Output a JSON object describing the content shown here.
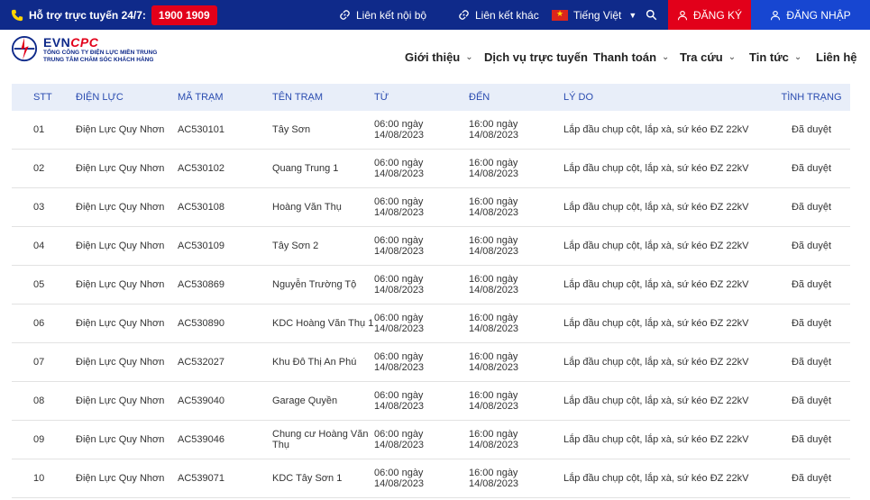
{
  "topbar": {
    "support_label": "Hỗ trợ trực tuyến 24/7:",
    "hotline": "1900 1909",
    "internal_link": "Liên kết nội bộ",
    "other_link": "Liên kết khác",
    "language": "Tiếng Việt",
    "register": "ĐĂNG KÝ",
    "login": "ĐĂNG NHẬP"
  },
  "logo": {
    "brand_evn": "EVN",
    "brand_cpc": "CPC",
    "line1": "TỔNG CÔNG TY ĐIỆN LỰC MIỀN TRUNG",
    "line2": "TRUNG TÂM CHĂM SÓC KHÁCH HÀNG"
  },
  "nav": [
    "Giới thiệu",
    "Dịch vụ trực tuyến",
    "Thanh toán",
    "Tra cứu",
    "Tin tức",
    "Liên hệ"
  ],
  "table": {
    "headers": [
      "STT",
      "ĐIỆN LỰC",
      "MÃ TRẠM",
      "TÊN TRẠM",
      "TỪ",
      "ĐẾN",
      "LÝ DO",
      "TÌNH TRẠNG"
    ],
    "rows": [
      {
        "stt": "01",
        "dl": "Điện Lực Quy Nhơn",
        "ma": "AC530101",
        "ten": "Tây Sơn",
        "tu": "06:00 ngày 14/08/2023",
        "den": "16:00 ngày 14/08/2023",
        "ly": "Lắp đầu chụp cột, lắp xà, sứ kéo ĐZ 22kV",
        "tt": "Đã duyệt"
      },
      {
        "stt": "02",
        "dl": "Điện Lực Quy Nhơn",
        "ma": "AC530102",
        "ten": "Quang Trung 1",
        "tu": "06:00 ngày 14/08/2023",
        "den": "16:00 ngày 14/08/2023",
        "ly": "Lắp đầu chụp cột, lắp xà, sứ kéo ĐZ 22kV",
        "tt": "Đã duyệt"
      },
      {
        "stt": "03",
        "dl": "Điện Lực Quy Nhơn",
        "ma": "AC530108",
        "ten": "Hoàng Văn Thụ",
        "tu": "06:00 ngày 14/08/2023",
        "den": "16:00 ngày 14/08/2023",
        "ly": "Lắp đầu chụp cột, lắp xà, sứ kéo ĐZ 22kV",
        "tt": "Đã duyệt"
      },
      {
        "stt": "04",
        "dl": "Điện Lực Quy Nhơn",
        "ma": "AC530109",
        "ten": "Tây Sơn 2",
        "tu": "06:00 ngày 14/08/2023",
        "den": "16:00 ngày 14/08/2023",
        "ly": "Lắp đầu chụp cột, lắp xà, sứ kéo ĐZ 22kV",
        "tt": "Đã duyệt"
      },
      {
        "stt": "05",
        "dl": "Điện Lực Quy Nhơn",
        "ma": "AC530869",
        "ten": "Nguyễn Trường Tộ",
        "tu": "06:00 ngày 14/08/2023",
        "den": "16:00 ngày 14/08/2023",
        "ly": "Lắp đầu chụp cột, lắp xà, sứ kéo ĐZ 22kV",
        "tt": "Đã duyệt"
      },
      {
        "stt": "06",
        "dl": "Điện Lực Quy Nhơn",
        "ma": "AC530890",
        "ten": "KDC Hoàng Văn Thụ 1",
        "tu": "06:00 ngày 14/08/2023",
        "den": "16:00 ngày 14/08/2023",
        "ly": "Lắp đầu chụp cột, lắp xà, sứ kéo ĐZ 22kV",
        "tt": "Đã duyệt"
      },
      {
        "stt": "07",
        "dl": "Điện Lực Quy Nhơn",
        "ma": "AC532027",
        "ten": "Khu Đô Thị An Phú",
        "tu": "06:00 ngày 14/08/2023",
        "den": "16:00 ngày 14/08/2023",
        "ly": "Lắp đầu chụp cột, lắp xà, sứ kéo ĐZ 22kV",
        "tt": "Đã duyệt"
      },
      {
        "stt": "08",
        "dl": "Điện Lực Quy Nhơn",
        "ma": "AC539040",
        "ten": "Garage Quyền",
        "tu": "06:00 ngày 14/08/2023",
        "den": "16:00 ngày 14/08/2023",
        "ly": "Lắp đầu chụp cột, lắp xà, sứ kéo ĐZ 22kV",
        "tt": "Đã duyệt"
      },
      {
        "stt": "09",
        "dl": "Điện Lực Quy Nhơn",
        "ma": "AC539046",
        "ten": "Chung cư Hoàng Văn Thụ",
        "tu": "06:00 ngày 14/08/2023",
        "den": "16:00 ngày 14/08/2023",
        "ly": "Lắp đầu chụp cột, lắp xà, sứ kéo ĐZ 22kV",
        "tt": "Đã duyệt"
      },
      {
        "stt": "10",
        "dl": "Điện Lực Quy Nhơn",
        "ma": "AC539071",
        "ten": "KDC Tây Sơn 1",
        "tu": "06:00 ngày 14/08/2023",
        "den": "16:00 ngày 14/08/2023",
        "ly": "Lắp đầu chụp cột, lắp xà, sứ kéo ĐZ 22kV",
        "tt": "Đã duyệt"
      }
    ]
  },
  "colors": {
    "topbar_bg": "#0f2a8a",
    "accent_red": "#e2001a",
    "login_blue": "#1746d1",
    "table_header_bg": "#e8eef9"
  }
}
